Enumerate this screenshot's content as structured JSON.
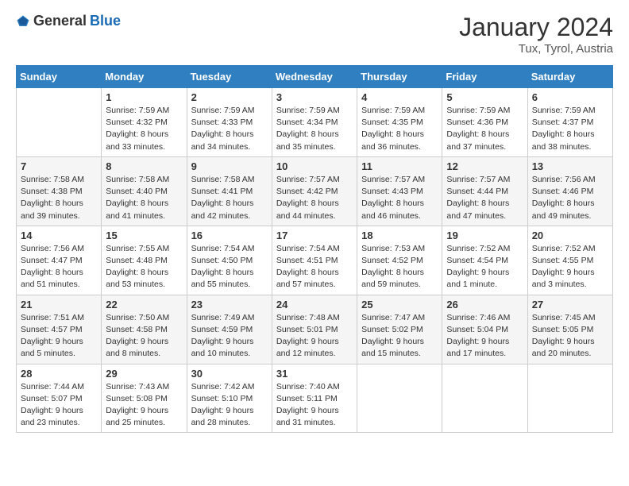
{
  "header": {
    "logo_general": "General",
    "logo_blue": "Blue",
    "month_year": "January 2024",
    "location": "Tux, Tyrol, Austria"
  },
  "days_of_week": [
    "Sunday",
    "Monday",
    "Tuesday",
    "Wednesday",
    "Thursday",
    "Friday",
    "Saturday"
  ],
  "weeks": [
    [
      {
        "day": "",
        "info": ""
      },
      {
        "day": "1",
        "info": "Sunrise: 7:59 AM\nSunset: 4:32 PM\nDaylight: 8 hours\nand 33 minutes."
      },
      {
        "day": "2",
        "info": "Sunrise: 7:59 AM\nSunset: 4:33 PM\nDaylight: 8 hours\nand 34 minutes."
      },
      {
        "day": "3",
        "info": "Sunrise: 7:59 AM\nSunset: 4:34 PM\nDaylight: 8 hours\nand 35 minutes."
      },
      {
        "day": "4",
        "info": "Sunrise: 7:59 AM\nSunset: 4:35 PM\nDaylight: 8 hours\nand 36 minutes."
      },
      {
        "day": "5",
        "info": "Sunrise: 7:59 AM\nSunset: 4:36 PM\nDaylight: 8 hours\nand 37 minutes."
      },
      {
        "day": "6",
        "info": "Sunrise: 7:59 AM\nSunset: 4:37 PM\nDaylight: 8 hours\nand 38 minutes."
      }
    ],
    [
      {
        "day": "7",
        "info": "Sunrise: 7:58 AM\nSunset: 4:38 PM\nDaylight: 8 hours\nand 39 minutes."
      },
      {
        "day": "8",
        "info": "Sunrise: 7:58 AM\nSunset: 4:40 PM\nDaylight: 8 hours\nand 41 minutes."
      },
      {
        "day": "9",
        "info": "Sunrise: 7:58 AM\nSunset: 4:41 PM\nDaylight: 8 hours\nand 42 minutes."
      },
      {
        "day": "10",
        "info": "Sunrise: 7:57 AM\nSunset: 4:42 PM\nDaylight: 8 hours\nand 44 minutes."
      },
      {
        "day": "11",
        "info": "Sunrise: 7:57 AM\nSunset: 4:43 PM\nDaylight: 8 hours\nand 46 minutes."
      },
      {
        "day": "12",
        "info": "Sunrise: 7:57 AM\nSunset: 4:44 PM\nDaylight: 8 hours\nand 47 minutes."
      },
      {
        "day": "13",
        "info": "Sunrise: 7:56 AM\nSunset: 4:46 PM\nDaylight: 8 hours\nand 49 minutes."
      }
    ],
    [
      {
        "day": "14",
        "info": "Sunrise: 7:56 AM\nSunset: 4:47 PM\nDaylight: 8 hours\nand 51 minutes."
      },
      {
        "day": "15",
        "info": "Sunrise: 7:55 AM\nSunset: 4:48 PM\nDaylight: 8 hours\nand 53 minutes."
      },
      {
        "day": "16",
        "info": "Sunrise: 7:54 AM\nSunset: 4:50 PM\nDaylight: 8 hours\nand 55 minutes."
      },
      {
        "day": "17",
        "info": "Sunrise: 7:54 AM\nSunset: 4:51 PM\nDaylight: 8 hours\nand 57 minutes."
      },
      {
        "day": "18",
        "info": "Sunrise: 7:53 AM\nSunset: 4:52 PM\nDaylight: 8 hours\nand 59 minutes."
      },
      {
        "day": "19",
        "info": "Sunrise: 7:52 AM\nSunset: 4:54 PM\nDaylight: 9 hours\nand 1 minute."
      },
      {
        "day": "20",
        "info": "Sunrise: 7:52 AM\nSunset: 4:55 PM\nDaylight: 9 hours\nand 3 minutes."
      }
    ],
    [
      {
        "day": "21",
        "info": "Sunrise: 7:51 AM\nSunset: 4:57 PM\nDaylight: 9 hours\nand 5 minutes."
      },
      {
        "day": "22",
        "info": "Sunrise: 7:50 AM\nSunset: 4:58 PM\nDaylight: 9 hours\nand 8 minutes."
      },
      {
        "day": "23",
        "info": "Sunrise: 7:49 AM\nSunset: 4:59 PM\nDaylight: 9 hours\nand 10 minutes."
      },
      {
        "day": "24",
        "info": "Sunrise: 7:48 AM\nSunset: 5:01 PM\nDaylight: 9 hours\nand 12 minutes."
      },
      {
        "day": "25",
        "info": "Sunrise: 7:47 AM\nSunset: 5:02 PM\nDaylight: 9 hours\nand 15 minutes."
      },
      {
        "day": "26",
        "info": "Sunrise: 7:46 AM\nSunset: 5:04 PM\nDaylight: 9 hours\nand 17 minutes."
      },
      {
        "day": "27",
        "info": "Sunrise: 7:45 AM\nSunset: 5:05 PM\nDaylight: 9 hours\nand 20 minutes."
      }
    ],
    [
      {
        "day": "28",
        "info": "Sunrise: 7:44 AM\nSunset: 5:07 PM\nDaylight: 9 hours\nand 23 minutes."
      },
      {
        "day": "29",
        "info": "Sunrise: 7:43 AM\nSunset: 5:08 PM\nDaylight: 9 hours\nand 25 minutes."
      },
      {
        "day": "30",
        "info": "Sunrise: 7:42 AM\nSunset: 5:10 PM\nDaylight: 9 hours\nand 28 minutes."
      },
      {
        "day": "31",
        "info": "Sunrise: 7:40 AM\nSunset: 5:11 PM\nDaylight: 9 hours\nand 31 minutes."
      },
      {
        "day": "",
        "info": ""
      },
      {
        "day": "",
        "info": ""
      },
      {
        "day": "",
        "info": ""
      }
    ]
  ]
}
